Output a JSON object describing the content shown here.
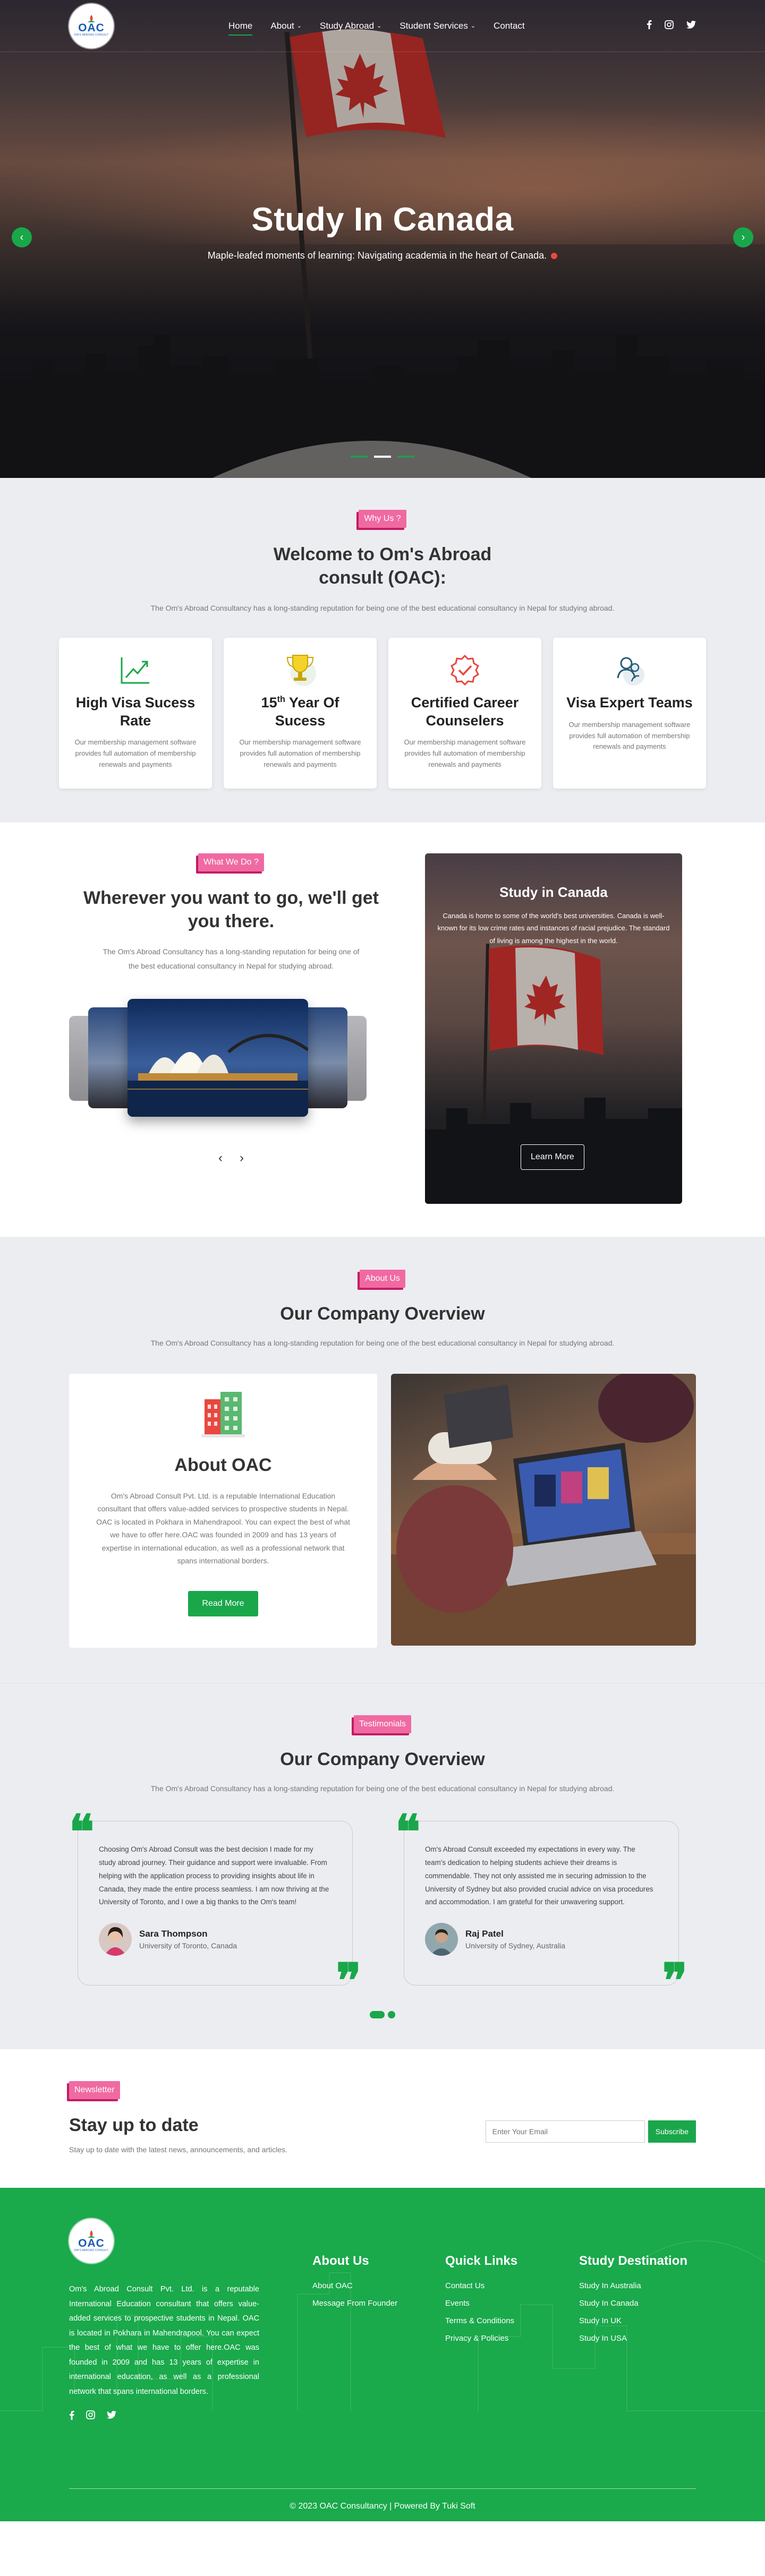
{
  "brand": {
    "logo_text": "OAC",
    "logo_sub": "OM'S ABROAD CONSULT"
  },
  "nav": {
    "items": [
      {
        "label": "Home",
        "active": true,
        "dropdown": false
      },
      {
        "label": "About",
        "active": false,
        "dropdown": true
      },
      {
        "label": "Study Abroad",
        "active": false,
        "dropdown": true
      },
      {
        "label": "Student Services",
        "active": false,
        "dropdown": true
      },
      {
        "label": "Contact",
        "active": false,
        "dropdown": false
      }
    ],
    "social": [
      "facebook-icon",
      "instagram-icon",
      "twitter-icon"
    ]
  },
  "hero": {
    "title": "Study In Canada",
    "subtitle": "Maple-leafed moments of learning: Navigating academia in the heart of Canada.",
    "slide_count": 3,
    "active_slide": 2
  },
  "why": {
    "tag": "Why Us ?",
    "title": "Welcome to Om's Abroad consult (OAC):",
    "lead": "The Om's Abroad Consultancy has a long-standing reputation for being one of the best educational consultancy in Nepal for studying abroad.",
    "cards": [
      {
        "icon": "chart-growth-icon",
        "title": "High Visa Sucess Rate",
        "text": "Our membership management software provides full automation of membership renewals and payments"
      },
      {
        "icon": "trophy-icon",
        "title": "15th Year Of Sucess",
        "text": "Our membership management software provides full automation of membership renewals and payments"
      },
      {
        "icon": "badge-check-icon",
        "title": "Certified Career Counselers",
        "text": "Our membership management software provides full automation of membership renewals and payments"
      },
      {
        "icon": "team-icon",
        "title": "Visa Expert Teams",
        "text": "Our membership management software provides full automation of membership renewals and payments"
      }
    ]
  },
  "whatwedo": {
    "tag": "What We Do ?",
    "title": "Wherever you want to go, we'll get you there.",
    "lead": "The Om's Abroad Consultancy has a long-standing reputation for being one of the best educational consultancy in Nepal for studying abroad.",
    "feature": {
      "title": "Study in Canada",
      "text": "Canada is home to some of the world's best universities. Canada is well-known for its low crime rates and instances of racial prejudice. The standard of living is among the highest in the world.",
      "button": "Learn More"
    }
  },
  "about": {
    "tag": "About Us",
    "title": "Our Company Overview",
    "lead": "The Om's Abroad Consultancy has a long-standing reputation for being one of the best educational consultancy in Nepal for studying abroad.",
    "card_title": "About OAC",
    "card_text": "Om's Abroad Consult Pvt. Ltd. is a reputable International Education consultant that offers value-added services to prospective students in Nepal. OAC is located in Pokhara in Mahendrapool. You can expect the best of what we have to offer here.OAC was founded in 2009 and has 13 years of expertise in international education, as well as a professional network that spans international borders.",
    "button": "Read More"
  },
  "testimonials": {
    "tag": "Testimonials",
    "title": "Our Company Overview",
    "lead": "The Om's Abroad Consultancy has a long-standing reputation for being one of the best educational consultancy in Nepal for studying abroad.",
    "items": [
      {
        "text": "Choosing Om's Abroad Consult was the best decision I made for my study abroad journey. Their guidance and support were invaluable. From helping with the application process to providing insights about life in Canada, they made the entire process seamless. I am now thriving at the University of Toronto, and I owe a big thanks to the Om's team!",
        "name": "Sara Thompson",
        "school": "University of Toronto, Canada"
      },
      {
        "text": "Om's Abroad Consult exceeded my expectations in every way. The team's dedication to helping students achieve their dreams is commendable. They not only assisted me in securing admission to the University of Sydney but also provided crucial advice on visa procedures and accommodation. I am grateful for their unwavering support.",
        "name": "Raj Patel",
        "school": "University of Sydney, Australia"
      }
    ]
  },
  "newsletter": {
    "tag": "Newsletter",
    "title": "Stay up to date",
    "text": "Stay up to date with the latest news, announcements, and articles.",
    "placeholder": "Enter Your Email",
    "button": "Subscribe"
  },
  "footer": {
    "about_text": "Om's Abroad Consult Pvt. Ltd. is a reputable International Education consultant that offers value-added services to prospective students in Nepal. OAC is located in Pokhara in Mahendrapool. You can expect the best of what we have to offer here.OAC was founded in 2009 and has 13 years of expertise in international education, as well as a professional network that spans international borders.",
    "columns": [
      {
        "title": "About Us",
        "links": [
          "About OAC",
          "Message From Founder"
        ]
      },
      {
        "title": "Quick Links",
        "links": [
          "Contact Us",
          "Events",
          "Terms & Conditions",
          "Privacy & Policies"
        ]
      },
      {
        "title": "Study Destination",
        "links": [
          "Study In Australia",
          "Study In Canada",
          "Study In UK",
          "Study In USA"
        ]
      }
    ],
    "copyright": "© 2023 OAC Consultancy | Powered By Tuki Soft"
  },
  "colors": {
    "accent": "#19a74a",
    "tag": "#f06aa2",
    "tag_shadow": "#c41b63",
    "section_bg": "#ecedf1"
  }
}
